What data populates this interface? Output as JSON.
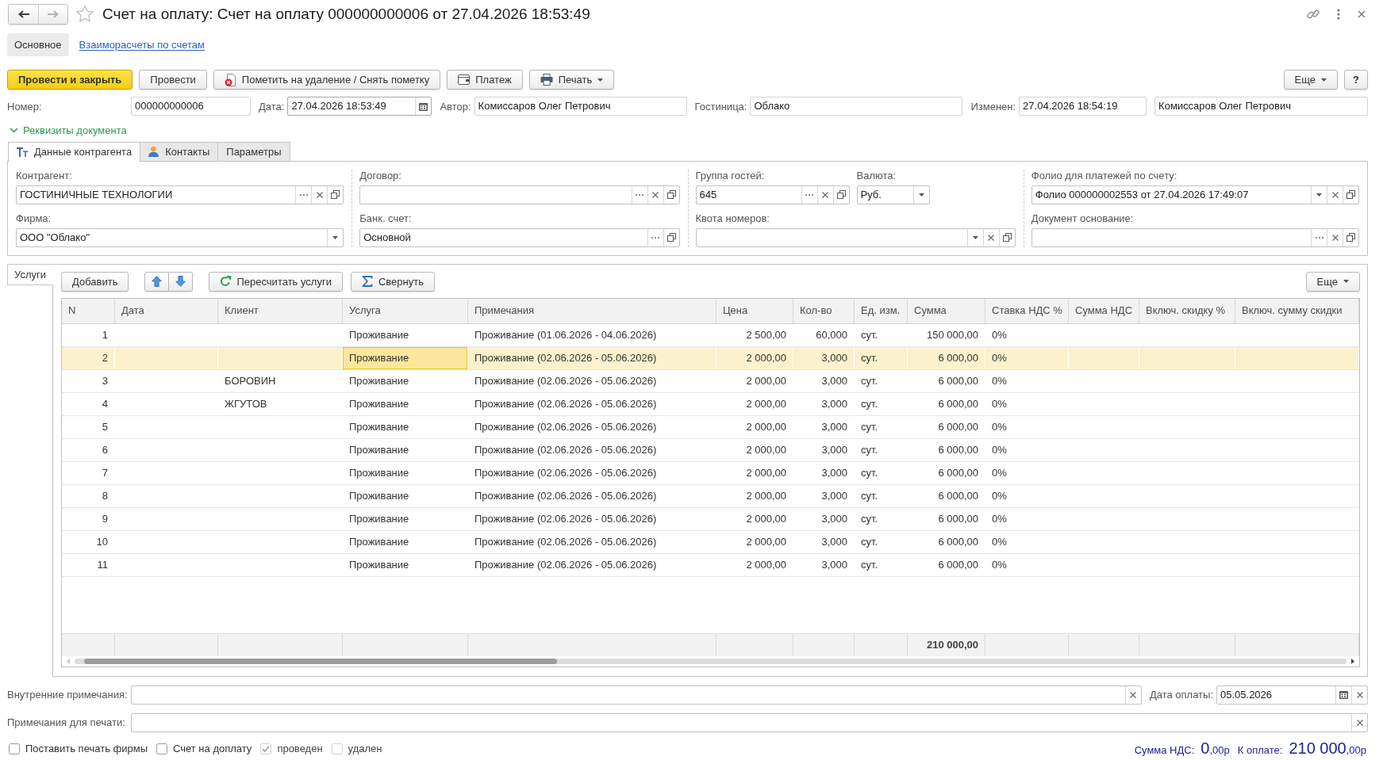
{
  "window": {
    "title": "Счет на оплату: Счет на оплату 000000000006 от 27.04.2026 18:53:49",
    "nav_buttons": [
      {
        "kind": "back",
        "disabled": false
      },
      {
        "kind": "forward",
        "disabled": true
      }
    ]
  },
  "sections": [
    {
      "label": "Основное",
      "selected": true
    },
    {
      "label": "Взаиморасчеты по счетам",
      "selected": false
    }
  ],
  "command_bar": {
    "buttons": [
      {
        "kind": "primary",
        "label": "Провести и закрыть"
      },
      {
        "kind": "plain",
        "label": "Провести"
      },
      {
        "kind": "delete",
        "label": "Пометить на удаление / Снять пометку"
      },
      {
        "kind": "payment",
        "label": "Платеж"
      },
      {
        "kind": "print",
        "label": "Печать",
        "dropdown": true
      }
    ],
    "more": {
      "label": "Еще",
      "dropdown": true
    },
    "help": {
      "label": "?"
    }
  },
  "header_fields": [
    {
      "label": "Номер:",
      "value": "000000000006"
    },
    {
      "label": "Дата:",
      "value": "27.04.2026 18:53:49",
      "calendar": true
    },
    {
      "label": "Автор:",
      "value": "Комиссаров Олег Петрович"
    },
    {
      "label": "Гостиница:",
      "value": "Облако"
    },
    {
      "label": "Изменен:",
      "value": "27.04.2026 18:54:19"
    },
    {
      "value": "Комиссаров Олег Петрович"
    }
  ],
  "details_group": {
    "label": "Реквизиты документа",
    "expanded": true,
    "tabs": [
      {
        "kind": "text",
        "label": "Данные контрагента",
        "selected": true
      },
      {
        "kind": "person",
        "label": "Контакты",
        "selected": false
      },
      {
        "kind": "plain",
        "label": "Параметры",
        "selected": false
      }
    ],
    "columns": [
      [
        [
          {
            "label": "Контрагент:",
            "value": "ГОСТИНИЧНЫЕ ТЕХНОЛОГИИ",
            "choice": true,
            "clear": true,
            "open": true
          }
        ],
        [
          {
            "label": "Фирма:",
            "value": "ООО \"Облако\"",
            "dropdown": true
          }
        ]
      ],
      [
        [
          {
            "label": "Договор:",
            "choice": true,
            "clear": true,
            "open": true
          }
        ],
        [
          {
            "label": "Банк. счет:",
            "value": "Основной",
            "choice": true,
            "open": true
          }
        ]
      ],
      [
        [
          {
            "label": "Группа гостей:",
            "value": "645",
            "choice": true,
            "clear": true,
            "open": true
          },
          {
            "label": "Валюта:",
            "value": "Руб.",
            "dropdown": true
          }
        ],
        [
          {
            "label": "Квота номеров:",
            "dropdown": true,
            "clear": true,
            "open": true
          }
        ]
      ],
      [
        [
          {
            "label": "Фолио для платежей по счету:",
            "value": "Фолио 000000002553 от 27.04.2026 17:49:07",
            "dropdown": true,
            "clear": true,
            "open": true
          }
        ],
        [
          {
            "label": "Документ основание:",
            "choice": true,
            "clear": true,
            "open": true
          }
        ]
      ]
    ]
  },
  "services": {
    "tab": {
      "label": "Услуги",
      "selected": true
    },
    "buttons": [
      {
        "kind": "plain",
        "label": "Добавить"
      },
      {
        "kind": "move_up"
      },
      {
        "kind": "move_down"
      },
      {
        "kind": "recalc",
        "label": "Пересчитать услуги"
      },
      {
        "kind": "collapse",
        "label": "Свернуть"
      }
    ],
    "more": {
      "label": "Еще",
      "dropdown": true
    },
    "table": {
      "cell_focus": true,
      "columns": [
        "N",
        "Дата",
        "Клиент",
        "Услуга",
        "Примечания",
        "Цена",
        "Кол-во",
        "Ед. изм.",
        "Сумма",
        "Ставка НДС %",
        "Сумма НДС",
        "Включ. скидку %",
        "Включ. сумму скидки"
      ],
      "rows": [
        {
          "selected": false,
          "n": "1",
          "service": "Проживание",
          "notes": "Проживание (01.06.2026 - 04.06.2026)",
          "price": "2 500,00",
          "quantity": "60,000",
          "unit": "сут.",
          "amount": "150 000,00",
          "vat_rate": "0%"
        },
        {
          "selected": true,
          "n": "2",
          "service": "Проживание",
          "notes": "Проживание (02.06.2026 - 05.06.2026)",
          "price": "2 000,00",
          "quantity": "3,000",
          "unit": "сут.",
          "amount": "6 000,00",
          "vat_rate": "0%"
        },
        {
          "selected": false,
          "n": "3",
          "client": "БОРОВИН",
          "service": "Проживание",
          "notes": "Проживание (02.06.2026 - 05.06.2026)",
          "price": "2 000,00",
          "quantity": "3,000",
          "unit": "сут.",
          "amount": "6 000,00",
          "vat_rate": "0%"
        },
        {
          "selected": false,
          "n": "4",
          "client": "ЖГУТОВ",
          "service": "Проживание",
          "notes": "Проживание (02.06.2026 - 05.06.2026)",
          "price": "2 000,00",
          "quantity": "3,000",
          "unit": "сут.",
          "amount": "6 000,00",
          "vat_rate": "0%"
        },
        {
          "selected": false,
          "n": "5",
          "service": "Проживание",
          "notes": "Проживание (02.06.2026 - 05.06.2026)",
          "price": "2 000,00",
          "quantity": "3,000",
          "unit": "сут.",
          "amount": "6 000,00",
          "vat_rate": "0%"
        },
        {
          "selected": false,
          "n": "6",
          "service": "Проживание",
          "notes": "Проживание (02.06.2026 - 05.06.2026)",
          "price": "2 000,00",
          "quantity": "3,000",
          "unit": "сут.",
          "amount": "6 000,00",
          "vat_rate": "0%"
        },
        {
          "selected": false,
          "n": "7",
          "service": "Проживание",
          "notes": "Проживание (02.06.2026 - 05.06.2026)",
          "price": "2 000,00",
          "quantity": "3,000",
          "unit": "сут.",
          "amount": "6 000,00",
          "vat_rate": "0%"
        },
        {
          "selected": false,
          "n": "8",
          "service": "Проживание",
          "notes": "Проживание (02.06.2026 - 05.06.2026)",
          "price": "2 000,00",
          "quantity": "3,000",
          "unit": "сут.",
          "amount": "6 000,00",
          "vat_rate": "0%"
        },
        {
          "selected": false,
          "n": "9",
          "service": "Проживание",
          "notes": "Проживание (02.06.2026 - 05.06.2026)",
          "price": "2 000,00",
          "quantity": "3,000",
          "unit": "сут.",
          "amount": "6 000,00",
          "vat_rate": "0%"
        },
        {
          "selected": false,
          "n": "10",
          "service": "Проживание",
          "notes": "Проживание (02.06.2026 - 05.06.2026)",
          "price": "2 000,00",
          "quantity": "3,000",
          "unit": "сут.",
          "amount": "6 000,00",
          "vat_rate": "0%"
        },
        {
          "selected": false,
          "n": "11",
          "service": "Проживание",
          "notes": "Проживание (02.06.2026 - 05.06.2026)",
          "price": "2 000,00",
          "quantity": "3,000",
          "unit": "сут.",
          "amount": "6 000,00",
          "vat_rate": "0%"
        }
      ],
      "totals": {
        "amount": "210 000,00"
      }
    }
  },
  "notes": [
    [
      {
        "label": "Внутренние примечания:",
        "clear": true
      },
      {
        "label": "Дата оплаты:",
        "value": "05.05.2026",
        "calendar": true,
        "clear": true
      }
    ],
    [
      {
        "label": "Примечания для печати:",
        "clear": true
      }
    ]
  ],
  "flags": [
    {
      "label": "Поставить печать фирмы",
      "checked": false,
      "disabled": false
    },
    {
      "label": "Счет на доплату",
      "checked": false,
      "disabled": false
    },
    {
      "label": "проведен",
      "checked": true,
      "disabled": true
    },
    {
      "label": "удален",
      "checked": false,
      "disabled": true
    }
  ],
  "totals": [
    {
      "label": "Сумма НДС:",
      "whole": "0",
      "fraction": ",00р"
    },
    {
      "label": "К оплате:",
      "whole": "210 000",
      "fraction": ",00р"
    }
  ]
}
